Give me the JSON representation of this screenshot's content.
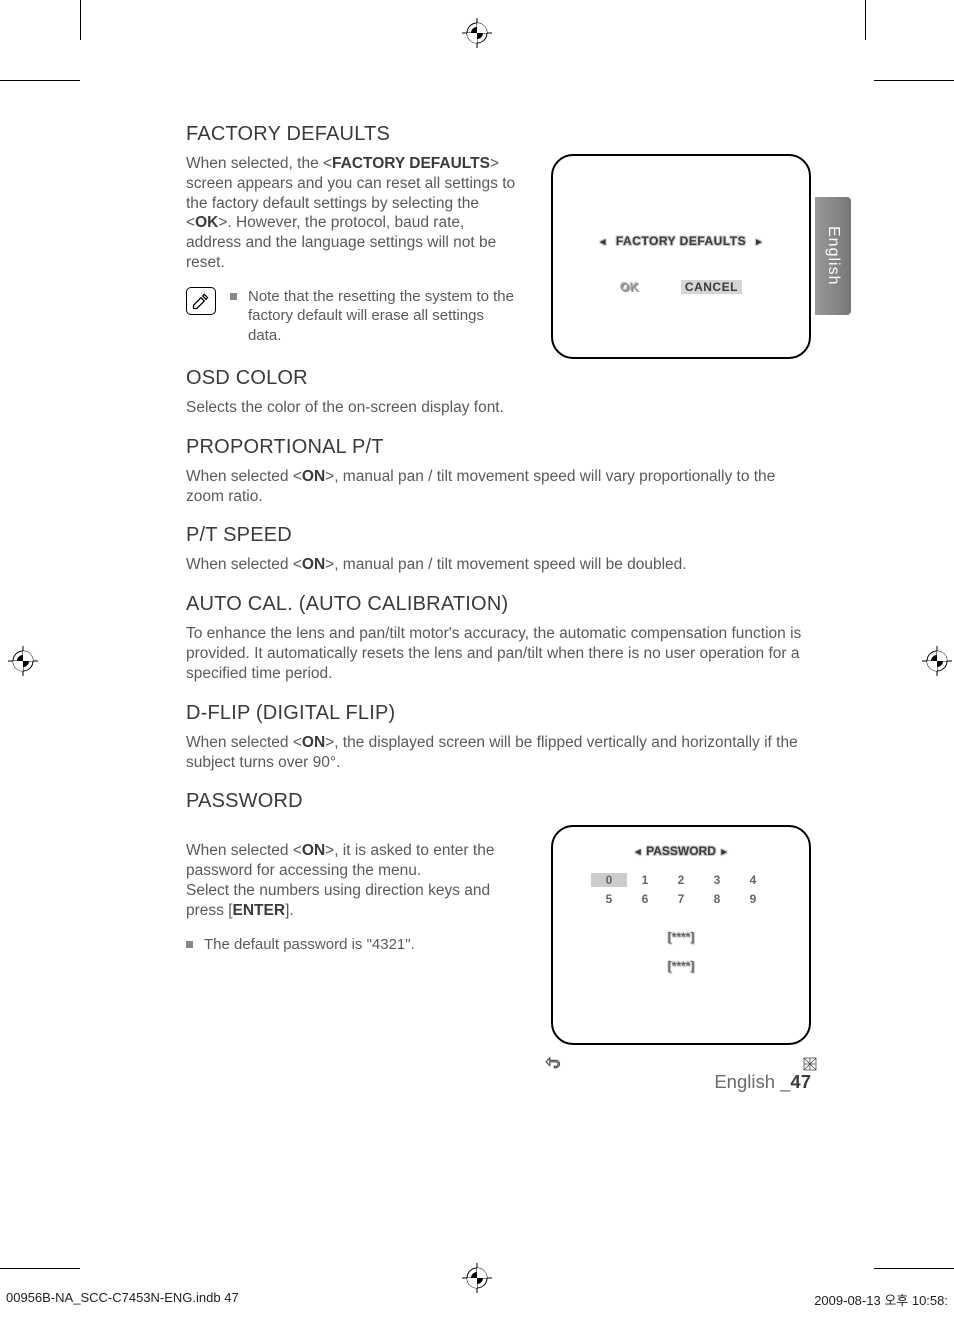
{
  "lang_tab": "English",
  "sections": {
    "factory_defaults": {
      "heading": "FACTORY DEFAULTS",
      "body_parts": [
        "When selected, the <",
        "FACTORY DEFAULTS",
        "> screen appears and you can reset all settings to the factory default settings by selecting the <",
        "OK",
        ">. However, the protocol, baud rate, address and the language settings will not be reset."
      ],
      "note": "Note that the resetting the system to the factory default will erase all settings data.",
      "osd": {
        "title": "FACTORY DEFAULTS",
        "ok": "OK",
        "cancel": "CANCEL"
      }
    },
    "osd_color": {
      "heading": "OSD COLOR",
      "body": "Selects the color of the on-screen display font."
    },
    "proportional": {
      "heading": "PROPORTIONAL P/T",
      "body_parts": [
        "When selected <",
        "ON",
        ">, manual pan / tilt movement speed will vary proportionally to the zoom ratio."
      ]
    },
    "pt_speed": {
      "heading": "P/T SPEED",
      "body_parts": [
        "When selected <",
        "ON",
        ">, manual pan / tilt movement speed will be doubled."
      ]
    },
    "auto_cal": {
      "heading": "AUTO CAL. (AUTO CALIBRATION)",
      "body": "To enhance the lens and pan/tilt motor's accuracy, the automatic compensation function is provided. It automatically resets the lens and pan/tilt when there is no user operation for a specified time period."
    },
    "d_flip": {
      "heading": "D-FLIP (DIGITAL FLIP)",
      "body_parts": [
        "When selected <",
        "ON",
        ">, the displayed screen will be flipped vertically and horizontally if the subject turns over 90°."
      ]
    },
    "password": {
      "heading": "PASSWORD",
      "body_parts": [
        "When selected <",
        "ON",
        ">, it is asked to enter the password for accessing the menu.\nSelect the numbers using direction keys and press [",
        "ENTER",
        "]."
      ],
      "bullet": "The default password is \"4321\".",
      "osd": {
        "title": "PASSWORD",
        "digits_row1": [
          "0",
          "1",
          "2",
          "3",
          "4"
        ],
        "digits_row2": [
          "5",
          "6",
          "7",
          "8",
          "9"
        ],
        "line1": "[****]",
        "line2": "[****]"
      }
    }
  },
  "footer": {
    "language": "English _",
    "page": "47"
  },
  "print_footer": {
    "left": "00956B-NA_SCC-C7453N-ENG.indb   47",
    "right": "2009-08-13   오후 10:58:"
  }
}
